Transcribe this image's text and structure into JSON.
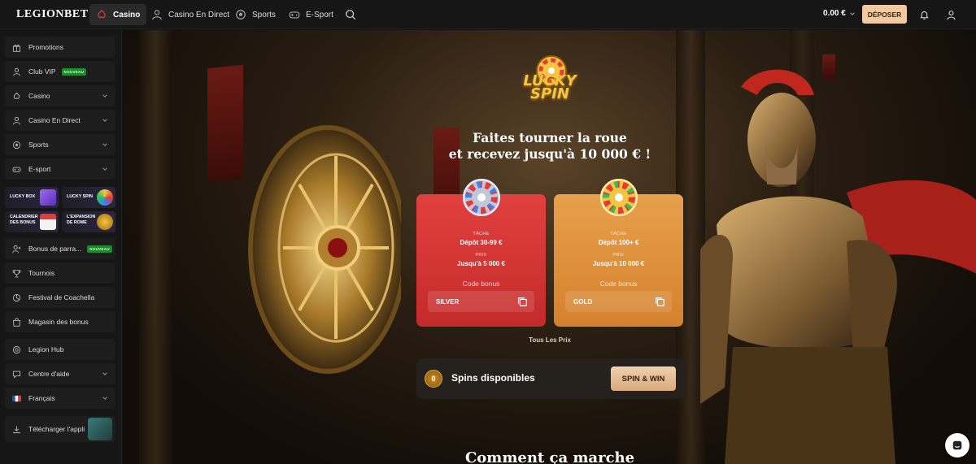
{
  "brand": {
    "logo": "LEGIONBET"
  },
  "topnav": {
    "items": [
      {
        "label": "Casino",
        "icon": "casino-icon"
      },
      {
        "label": "Casino En Direct",
        "icon": "dealer-icon"
      },
      {
        "label": "Sports",
        "icon": "soccer-ball-icon"
      },
      {
        "label": "E-Sport",
        "icon": "gamepad-icon"
      }
    ],
    "balance": "0.00 €",
    "deposit_label": "DÉPOSER"
  },
  "sidebar": {
    "items": [
      {
        "label": "Promotions",
        "icon": "gift-icon"
      },
      {
        "label": "Club VIP",
        "icon": "user-icon",
        "badge": "NOUVEAU"
      },
      {
        "label": "Casino",
        "icon": "casino-icon"
      },
      {
        "label": "Casino En Direct",
        "icon": "dealer-icon"
      },
      {
        "label": "Sports",
        "icon": "soccer-ball-icon"
      },
      {
        "label": "E-sport",
        "icon": "gamepad-icon"
      },
      {
        "label": "Bonus de parra...",
        "icon": "user-plus-icon",
        "badge": "NOUVEAU"
      },
      {
        "label": "Tournois",
        "icon": "trophy-icon"
      },
      {
        "label": "Festival de Coachella",
        "icon": "festival-icon"
      },
      {
        "label": "Magasin des bonus",
        "icon": "shop-icon"
      },
      {
        "label": "Legion Hub",
        "icon": "hub-icon"
      },
      {
        "label": "Centre d'aide",
        "icon": "help-icon"
      },
      {
        "label": "Français",
        "icon": "france-flag-icon"
      }
    ],
    "tiles": [
      {
        "label": "LUCKY BOX"
      },
      {
        "label": "LUCKY SPIN"
      },
      {
        "label": "CALENDRIER DES BONUS"
      },
      {
        "label": "L'EXPANSION DE ROME"
      }
    ],
    "app_download": "Télécharger l'appli"
  },
  "hero": {
    "logo_line1": "LUCKY",
    "logo_line2": "SPIN",
    "headline_line1": "Faites tourner la roue",
    "headline_line2": "et recevez jusqu'à 10 000 € !",
    "cards": [
      {
        "task_label": "TÂCHE",
        "task": "Dépôt 30-99 €",
        "prize_label": "PRIX",
        "prize": "Jusqu'à 5 000 €",
        "code_label": "Code bonus",
        "code": "SILVER",
        "color": "#d83636"
      },
      {
        "task_label": "TÂCHE",
        "task": "Dépôt 100+ €",
        "prize_label": "PRIX",
        "prize": "Jusqu'à 10 000 €",
        "code_label": "Code bonus",
        "code": "GOLD",
        "color": "#e0903a"
      }
    ],
    "all_prizes": "Tous Les Prix",
    "spins_count": "0",
    "spins_label": "Spins disponibles",
    "spin_button": "SPIN & WIN",
    "section_title": "Comment ça marche"
  },
  "colors": {
    "accent": "#f2c9a0",
    "new_badge": "#1e8a2e",
    "brand_red": "#e23b3b"
  }
}
